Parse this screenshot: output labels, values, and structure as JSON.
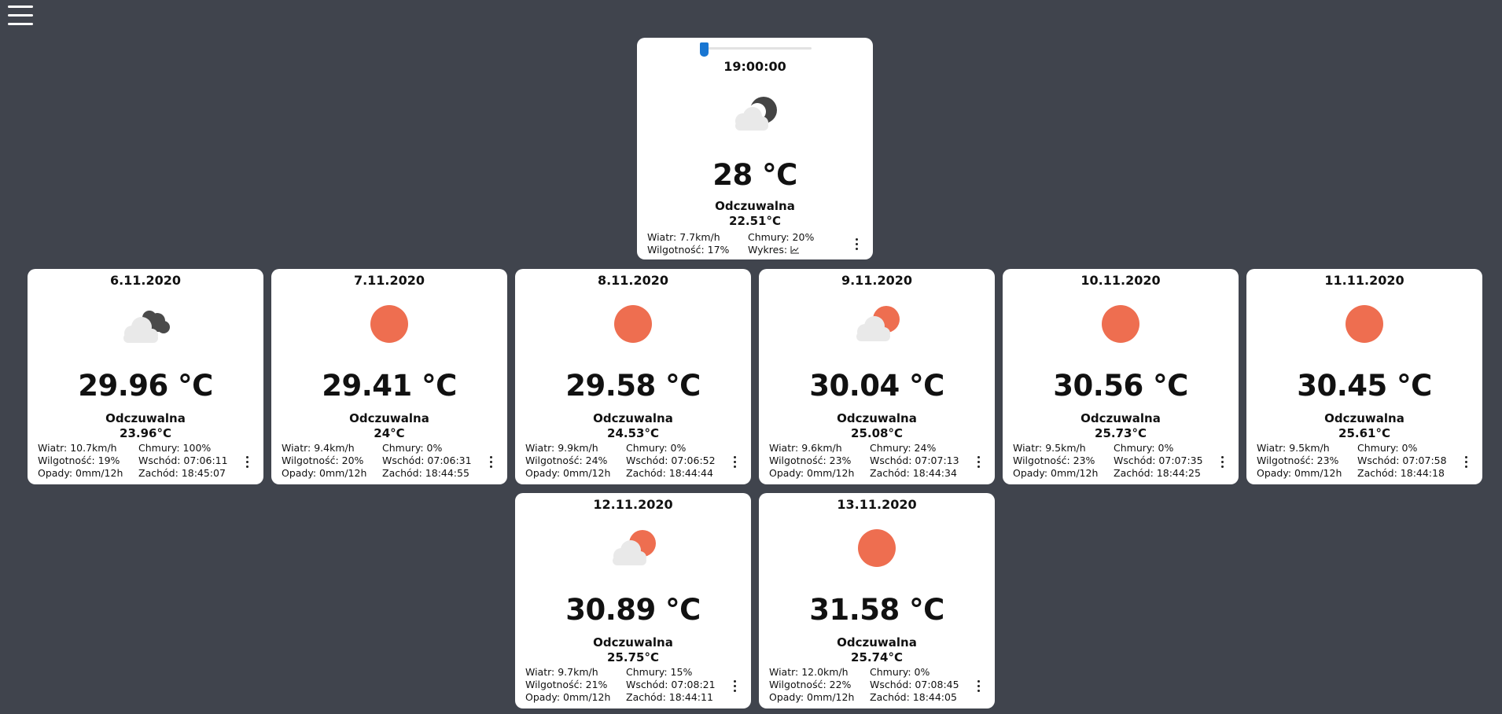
{
  "current": {
    "time": "19:00:00",
    "slider_position": 0.0,
    "icon": "cloud-night-icon",
    "temperature": "28 °C",
    "feels_label": "Odczuwalna",
    "feels_value": "22.51°C",
    "wind": "Wiatr: 7.7km/h",
    "clouds": "Chmury: 20%",
    "humidity": "Wilgotność: 17%",
    "chart_label": "Wykres:"
  },
  "days": [
    {
      "date": "6.11.2020",
      "icon": "cloud-dark-cloud-icon",
      "temperature": "29.96 °C",
      "feels_label": "Odczuwalna",
      "feels_value": "23.96°C",
      "wind": "Wiatr: 10.7km/h",
      "clouds": "Chmury: 100%",
      "humidity": "Wilgotność: 19%",
      "sunrise": "Wschód: 07:06:11",
      "rain": "Opady: 0mm/12h",
      "sunset": "Zachód: 18:45:07"
    },
    {
      "date": "7.11.2020",
      "icon": "sun-icon",
      "temperature": "29.41 °C",
      "feels_label": "Odczuwalna",
      "feels_value": "24°C",
      "wind": "Wiatr: 9.4km/h",
      "clouds": "Chmury: 0%",
      "humidity": "Wilgotność: 20%",
      "sunrise": "Wschód: 07:06:31",
      "rain": "Opady: 0mm/12h",
      "sunset": "Zachód: 18:44:55"
    },
    {
      "date": "8.11.2020",
      "icon": "sun-icon",
      "temperature": "29.58 °C",
      "feels_label": "Odczuwalna",
      "feels_value": "24.53°C",
      "wind": "Wiatr: 9.9km/h",
      "clouds": "Chmury: 0%",
      "humidity": "Wilgotność: 24%",
      "sunrise": "Wschód: 07:06:52",
      "rain": "Opady: 0mm/12h",
      "sunset": "Zachód: 18:44:44"
    },
    {
      "date": "9.11.2020",
      "icon": "cloud-sun-icon",
      "temperature": "30.04 °C",
      "feels_label": "Odczuwalna",
      "feels_value": "25.08°C",
      "wind": "Wiatr: 9.6km/h",
      "clouds": "Chmury: 24%",
      "humidity": "Wilgotność: 23%",
      "sunrise": "Wschód: 07:07:13",
      "rain": "Opady: 0mm/12h",
      "sunset": "Zachód: 18:44:34"
    },
    {
      "date": "10.11.2020",
      "icon": "sun-icon",
      "temperature": "30.56 °C",
      "feels_label": "Odczuwalna",
      "feels_value": "25.73°C",
      "wind": "Wiatr: 9.5km/h",
      "clouds": "Chmury: 0%",
      "humidity": "Wilgotność: 23%",
      "sunrise": "Wschód: 07:07:35",
      "rain": "Opady: 0mm/12h",
      "sunset": "Zachód: 18:44:25"
    },
    {
      "date": "11.11.2020",
      "icon": "sun-icon",
      "temperature": "30.45 °C",
      "feels_label": "Odczuwalna",
      "feels_value": "25.61°C",
      "wind": "Wiatr: 9.5km/h",
      "clouds": "Chmury: 0%",
      "humidity": "Wilgotność: 23%",
      "sunrise": "Wschód: 07:07:58",
      "rain": "Opady: 0mm/12h",
      "sunset": "Zachód: 18:44:18"
    },
    {
      "date": "12.11.2020",
      "icon": "cloud-sun-icon",
      "temperature": "30.89 °C",
      "feels_label": "Odczuwalna",
      "feels_value": "25.75°C",
      "wind": "Wiatr: 9.7km/h",
      "clouds": "Chmury: 15%",
      "humidity": "Wilgotność: 21%",
      "sunrise": "Wschód: 07:08:21",
      "rain": "Opady: 0mm/12h",
      "sunset": "Zachód: 18:44:11"
    },
    {
      "date": "13.11.2020",
      "icon": "sun-icon",
      "temperature": "31.58 °C",
      "feels_label": "Odczuwalna",
      "feels_value": "25.74°C",
      "wind": "Wiatr: 12.0km/h",
      "clouds": "Chmury: 0%",
      "humidity": "Wilgotność: 22%",
      "sunrise": "Wschód: 07:08:45",
      "rain": "Opady: 0mm/12h",
      "sunset": "Zachód: 18:44:05"
    }
  ],
  "colors": {
    "background": "#40444d",
    "sun": "#ee6e50",
    "cloud": "#e9e9e9",
    "dark_cloud": "#4a4a4a",
    "slider": "#1976d2"
  }
}
